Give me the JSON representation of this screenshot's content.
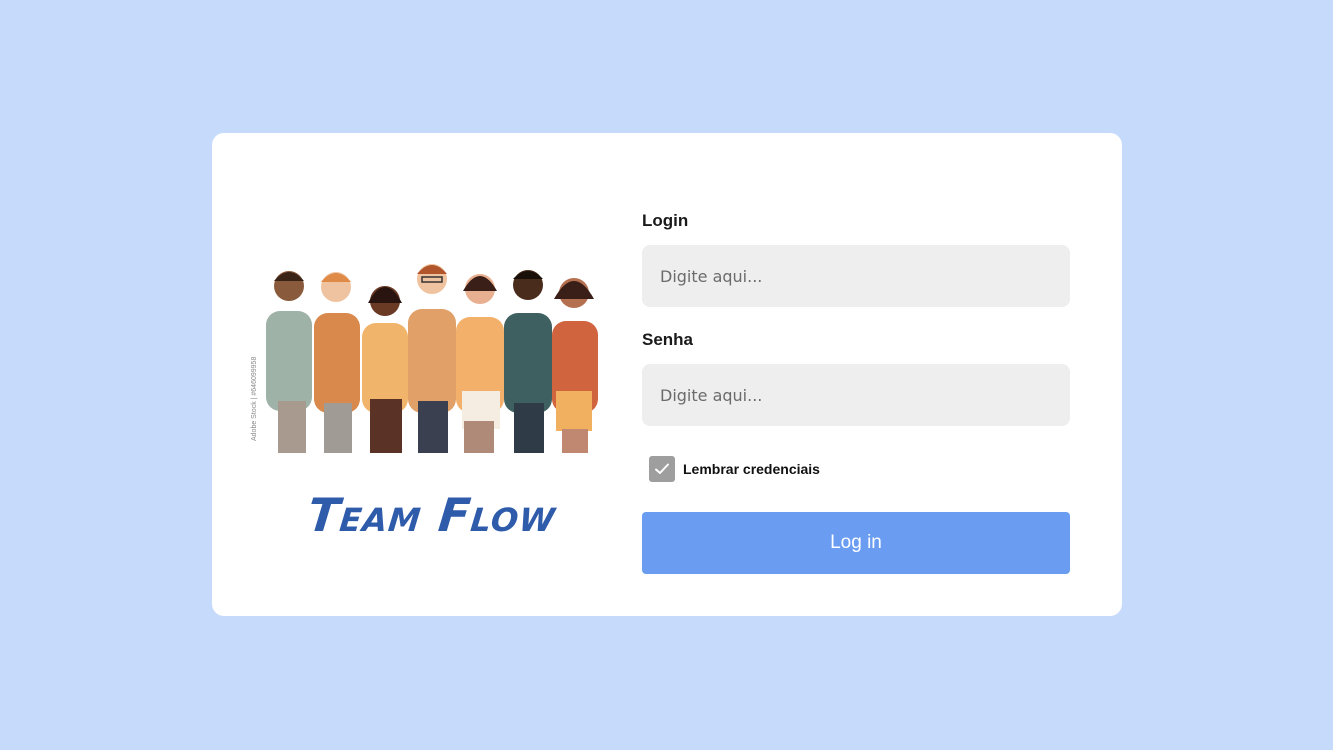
{
  "colors": {
    "page_background": "#c6dafc",
    "card_background": "#ffffff",
    "brand": "#2f5bab",
    "button": "#6a9df1",
    "input_background": "#eeeeee",
    "checkbox": "#9e9e9e"
  },
  "hero": {
    "image": "team-illustration",
    "watermark": "Adobe Stock | #646099958"
  },
  "brand": {
    "name": "Team Flow"
  },
  "form": {
    "login_label": "Login",
    "login_placeholder": "Digite aqui...",
    "password_label": "Senha",
    "password_placeholder": "Digite aqui...",
    "remember_label": "Lembrar credenciais",
    "remember_checked": true,
    "submit_label": "Log in"
  }
}
